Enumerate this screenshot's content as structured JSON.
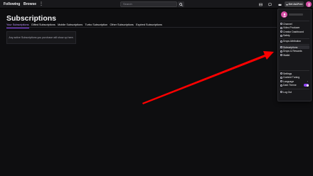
{
  "nav": {
    "following": "Following",
    "browse": "Browse",
    "more": "⋮",
    "search_placeholder": "Search",
    "ad_free": "Get Ad-Free"
  },
  "page": {
    "title": "Subscriptions",
    "tabs": [
      "Your Subscriptions",
      "Gifted Subscriptions",
      "Mobile Subscriptions",
      "Turbo Subscription",
      "Other Subscriptions",
      "Expired Subscriptions"
    ],
    "empty_message": "Any active Subscriptions you purchase will show up here."
  },
  "menu": {
    "items": [
      {
        "label": "Channel",
        "icon": "channel-icon"
      },
      {
        "label": "Video Producer",
        "icon": "video-producer-icon"
      },
      {
        "label": "Creator Dashboard",
        "icon": "dashboard-icon"
      },
      {
        "label": "Safety",
        "icon": "safety-icon"
      },
      {
        "label": "Drops Attribution",
        "icon": "attribution-icon"
      },
      {
        "label": "Subscriptions",
        "icon": "subscriptions-icon"
      },
      {
        "label": "Drops & Rewards",
        "icon": "drops-icon"
      },
      {
        "label": "Wallet",
        "icon": "wallet-icon"
      },
      {
        "label": "Settings",
        "icon": "gear-icon"
      },
      {
        "label": "Content Tuning",
        "icon": "tuning-icon"
      },
      {
        "label": "Language",
        "icon": "globe-icon"
      },
      {
        "label": "Dark Theme",
        "icon": "moon-icon"
      },
      {
        "label": "Log Out",
        "icon": "logout-icon"
      }
    ]
  },
  "colors": {
    "accent": "#9147ff",
    "avatar": "#d64ea5",
    "arrow": "#ff0000"
  }
}
